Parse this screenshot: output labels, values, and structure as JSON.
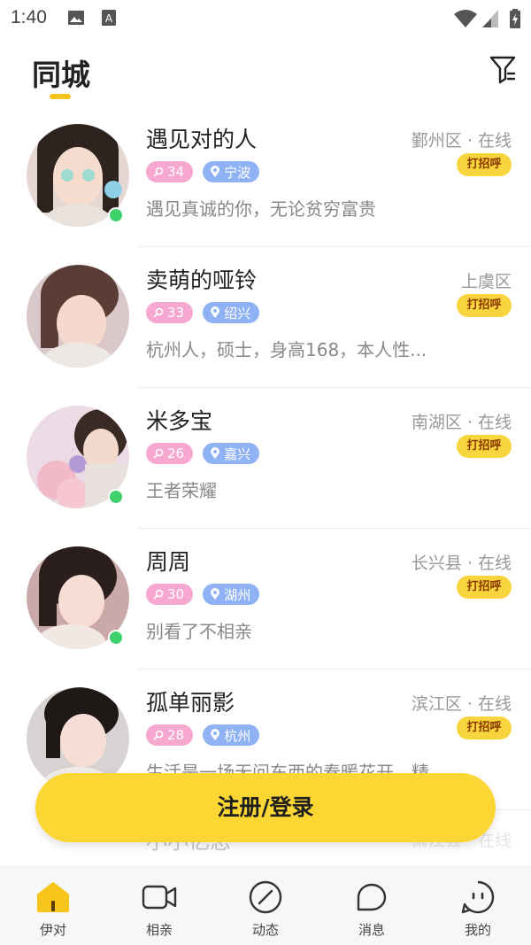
{
  "status_bar": {
    "time": "1:40"
  },
  "header": {
    "title": "同城"
  },
  "users": [
    {
      "name": "遇见对的人",
      "location": "鄞州区 · 在线",
      "age": "34",
      "city": "宁波",
      "bio": "遇见真诚的你，无论贫穷富贵",
      "online": true,
      "greet": "打招呼"
    },
    {
      "name": "卖萌的哑铃",
      "location": "上虞区",
      "age": "33",
      "city": "绍兴",
      "bio": "杭州人，硕士，身高168，本人性...",
      "online": false,
      "greet": "打招呼"
    },
    {
      "name": "米多宝",
      "location": "南湖区 · 在线",
      "age": "26",
      "city": "嘉兴",
      "bio": "王者荣耀",
      "online": true,
      "greet": "打招呼"
    },
    {
      "name": "周周",
      "location": "长兴县 · 在线",
      "age": "30",
      "city": "湖州",
      "bio": "别看了不相亲",
      "online": true,
      "greet": "打招呼"
    },
    {
      "name": "孤单丽影",
      "location": "滨江区 · 在线",
      "age": "28",
      "city": "杭州",
      "bio": "生活是一场无问东西的春暖花开，精...",
      "online": false,
      "greet": "打招呼"
    }
  ],
  "partial_row": {
    "name": "小小忆恋",
    "location": "萧江县 · 在线"
  },
  "register_button": "注册/登录",
  "tabs": [
    {
      "label": "伊对",
      "icon": "home-icon",
      "active": true
    },
    {
      "label": "相亲",
      "icon": "video-icon",
      "active": false
    },
    {
      "label": "动态",
      "icon": "compass-icon",
      "active": false
    },
    {
      "label": "消息",
      "icon": "message-icon",
      "active": false
    },
    {
      "label": "我的",
      "icon": "profile-icon",
      "active": false
    }
  ],
  "colors": {
    "accent": "#fcd734",
    "age_tag": "#f7a8d0",
    "city_tag": "#8fb2f4",
    "online": "#3ed06b"
  }
}
